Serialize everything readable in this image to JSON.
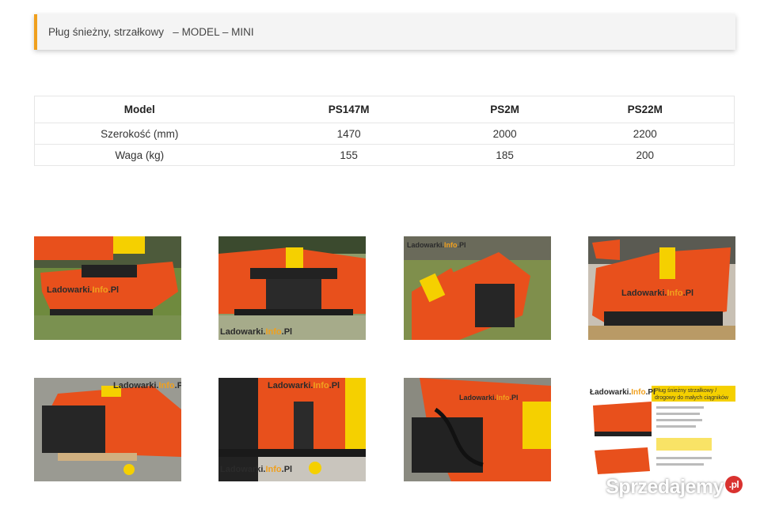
{
  "notice": {
    "text": "Pług śnieżny, strzałkowy   – MODEL – MINI"
  },
  "spec_table": {
    "headers": [
      "Model",
      "PS147M",
      "PS2M",
      "PS22M"
    ],
    "rows": [
      [
        "Szerokość (mm)",
        "1470",
        "2000",
        "2200"
      ],
      [
        "Waga (kg)",
        "155",
        "185",
        "200"
      ]
    ]
  },
  "gallery": {
    "watermark_prefix": "Ladowarki.",
    "watermark_accent": "Info",
    "watermark_suffix": ".Pl",
    "brochure": {
      "logo_prefix": "Ładowarki.",
      "logo_accent": "Info",
      "logo_suffix": ".Pl",
      "heading": "Pług śnieżny strzałkowy / drogowy do małych ciągników"
    }
  },
  "brand": {
    "name": "Sprzedajemy",
    "tld": ".pl"
  },
  "colors": {
    "accent": "#f0a01e",
    "plow_orange": "#e8501c",
    "plow_yellow": "#f5d000"
  }
}
